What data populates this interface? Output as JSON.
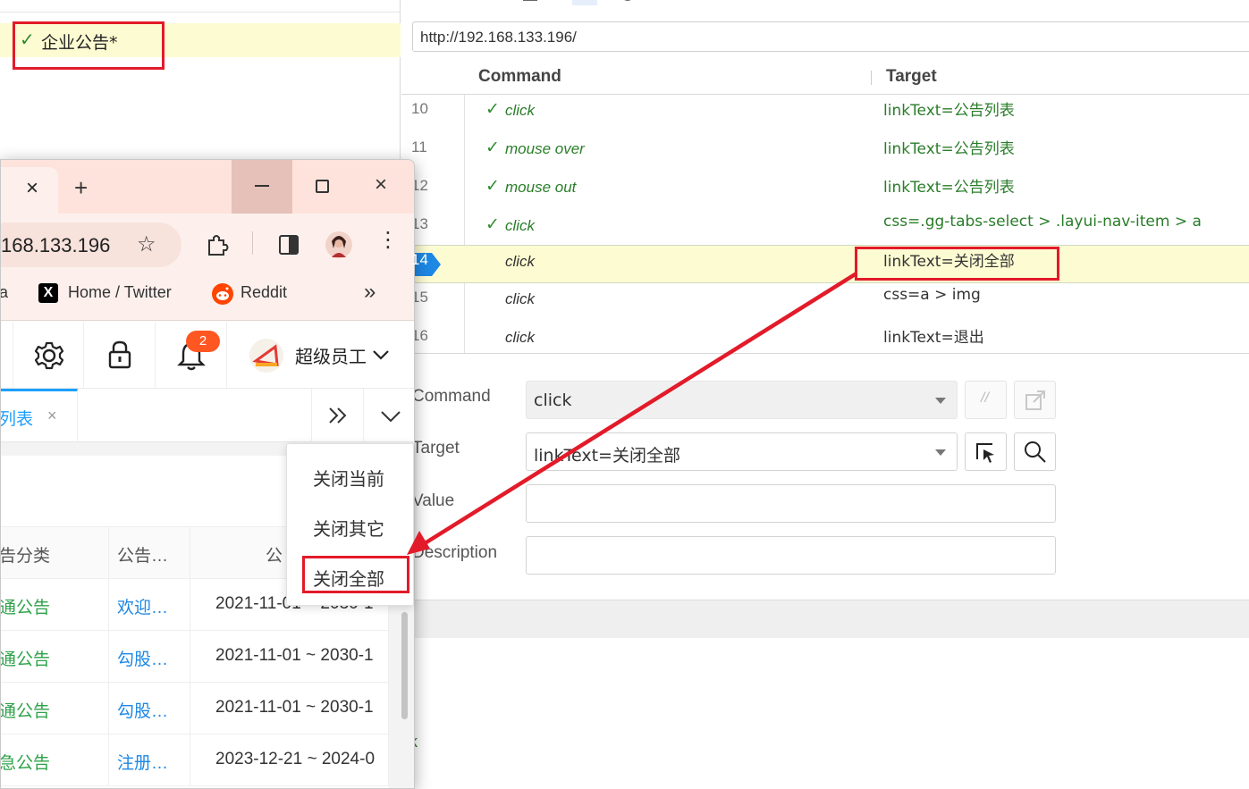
{
  "suite": {
    "check": "✓",
    "label": "企业公告*"
  },
  "ide": {
    "url": "http://192.168.133.196/",
    "col_command": "Command",
    "col_target": "Target",
    "rows": [
      {
        "num": "10",
        "check": "✓",
        "cmd": "click",
        "target": "linkText=公告列表"
      },
      {
        "num": "11",
        "check": "✓",
        "cmd": "mouse over",
        "target": "linkText=公告列表"
      },
      {
        "num": "12",
        "check": "✓",
        "cmd": "mouse out",
        "target": "linkText=公告列表"
      },
      {
        "num": "13",
        "check": "✓",
        "cmd": "click",
        "target": "css=.gg-tabs-select > .layui-nav-item > a"
      },
      {
        "num": "14",
        "check": "",
        "cmd": "click",
        "target": "linkText=关闭全部"
      },
      {
        "num": "15",
        "check": "",
        "cmd": "click",
        "target": "css=a > img"
      },
      {
        "num": "16",
        "check": "",
        "cmd": "click",
        "target": "linkText=退出"
      }
    ],
    "form": {
      "command_label": "Command",
      "command_value": "click",
      "target_label": "Target",
      "target_value": "linkText=关闭全部",
      "value_label": "Value",
      "value_value": "",
      "description_label": "Description",
      "description_value": "",
      "comment_btn": "//"
    },
    "log_fragment": "k"
  },
  "browser": {
    "tab_close": "×",
    "new_tab": "+",
    "close": "×",
    "url": "168.133.196",
    "star": "☆",
    "menu_dots": "⋮",
    "bookmarks": [
      {
        "label": "a"
      },
      {
        "label": "Home / Twitter",
        "icon_letter": "X",
        "color": "#000000"
      },
      {
        "label": "Reddit",
        "color": "#ff4500"
      }
    ],
    "bookmarks_more": "»",
    "header": {
      "badge": "2",
      "user_name": "超级员工"
    },
    "tab_label": "列表",
    "table": {
      "headers": [
        "告分类",
        "公告…",
        "公"
      ],
      "rows": [
        {
          "cat": "通公告",
          "title": "欢迎…",
          "date": "2021-11-01 ~ 2030-1"
        },
        {
          "cat": "通公告",
          "title": "勾股…",
          "date": "2021-11-01 ~ 2030-1"
        },
        {
          "cat": "通公告",
          "title": "勾股…",
          "date": "2021-11-01 ~ 2030-1"
        },
        {
          "cat": "急公告",
          "title": "注册…",
          "date": "2023-12-21 ~ 2024-0"
        }
      ]
    },
    "context_menu": [
      "关闭当前",
      "关闭其它",
      "关闭全部"
    ]
  },
  "colors": {
    "highlight": "#fdfbd2",
    "annotation_red": "#e21b2a",
    "pass_green": "#2a7d2a",
    "link_blue": "#1e9fff",
    "category_green": "#2fa24a",
    "badge": "#ff5722"
  }
}
